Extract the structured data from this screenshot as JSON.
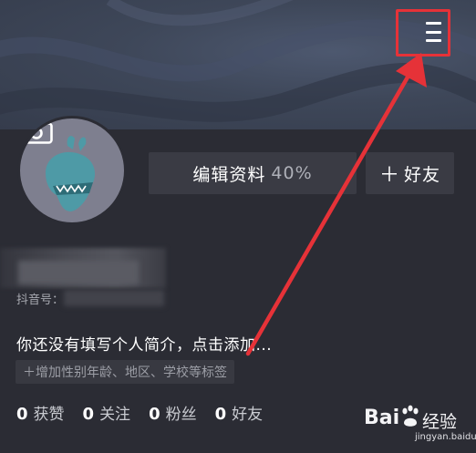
{
  "header": {
    "menu_icon": "hamburger-menu-icon"
  },
  "profile": {
    "avatar_icon": "camera-icon",
    "edit_button_label": "编辑资料",
    "edit_progress": "40%",
    "add_friend_label": "好友",
    "add_friend_icon": "plus-icon",
    "douyin_id_label": "抖音号："
  },
  "bio": {
    "text": "你还没有填写个人简介，点击添加...",
    "tag_hint": "＋增加性别年龄、地区、学校等标签"
  },
  "stats": [
    {
      "count": "0",
      "label": "获赞"
    },
    {
      "count": "0",
      "label": "关注"
    },
    {
      "count": "0",
      "label": "粉丝"
    },
    {
      "count": "0",
      "label": "好友"
    }
  ],
  "watermark": {
    "brand": "Bai",
    "brand_cn": "经验",
    "url": "jingyan.baidu.com"
  },
  "colors": {
    "annotation": "#e63238",
    "background": "#2b2c34",
    "button": "#3a3b44"
  }
}
